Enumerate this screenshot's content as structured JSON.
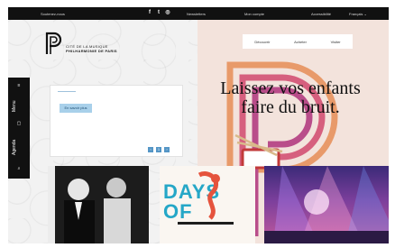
{
  "topbar": {
    "support": "Soutenez-nous",
    "social_icons": [
      "facebook-icon",
      "twitter-icon",
      "instagram-icon"
    ],
    "social_glyphs": [
      "f",
      "t",
      "◎"
    ],
    "newsletters": "Newsletters",
    "mon_compte": "Mon compte",
    "accessibilite": "Accessibilité",
    "language": "Français ⌄"
  },
  "brand": {
    "line1": "CITÉ DE LA MUSIQUE",
    "line2": "PHILHARMONIE DE PARIS"
  },
  "nav": {
    "decouvrir": "Découvrir",
    "acheter": "Acheter",
    "visiter": "Visiter"
  },
  "sidebar": {
    "menu": "Menu",
    "agenda": "Agenda",
    "menu_glyph": "≡",
    "agenda_glyph": "▢",
    "search_glyph": "⌕"
  },
  "card": {
    "button": "En savoir plus",
    "pager": [
      "‹",
      "1",
      "›"
    ]
  },
  "hero": {
    "headline_line1": "Laissez vos enfants",
    "headline_line2": "faire du bruit."
  },
  "tiles": {
    "days_of": "DAYS OF"
  },
  "colors": {
    "topbar_bg": "#111111",
    "hero_bg": "#f3e3dc",
    "accent_blue": "#5596c6",
    "logo_orange": "#e89a6a",
    "logo_pink": "#d65f7e"
  }
}
